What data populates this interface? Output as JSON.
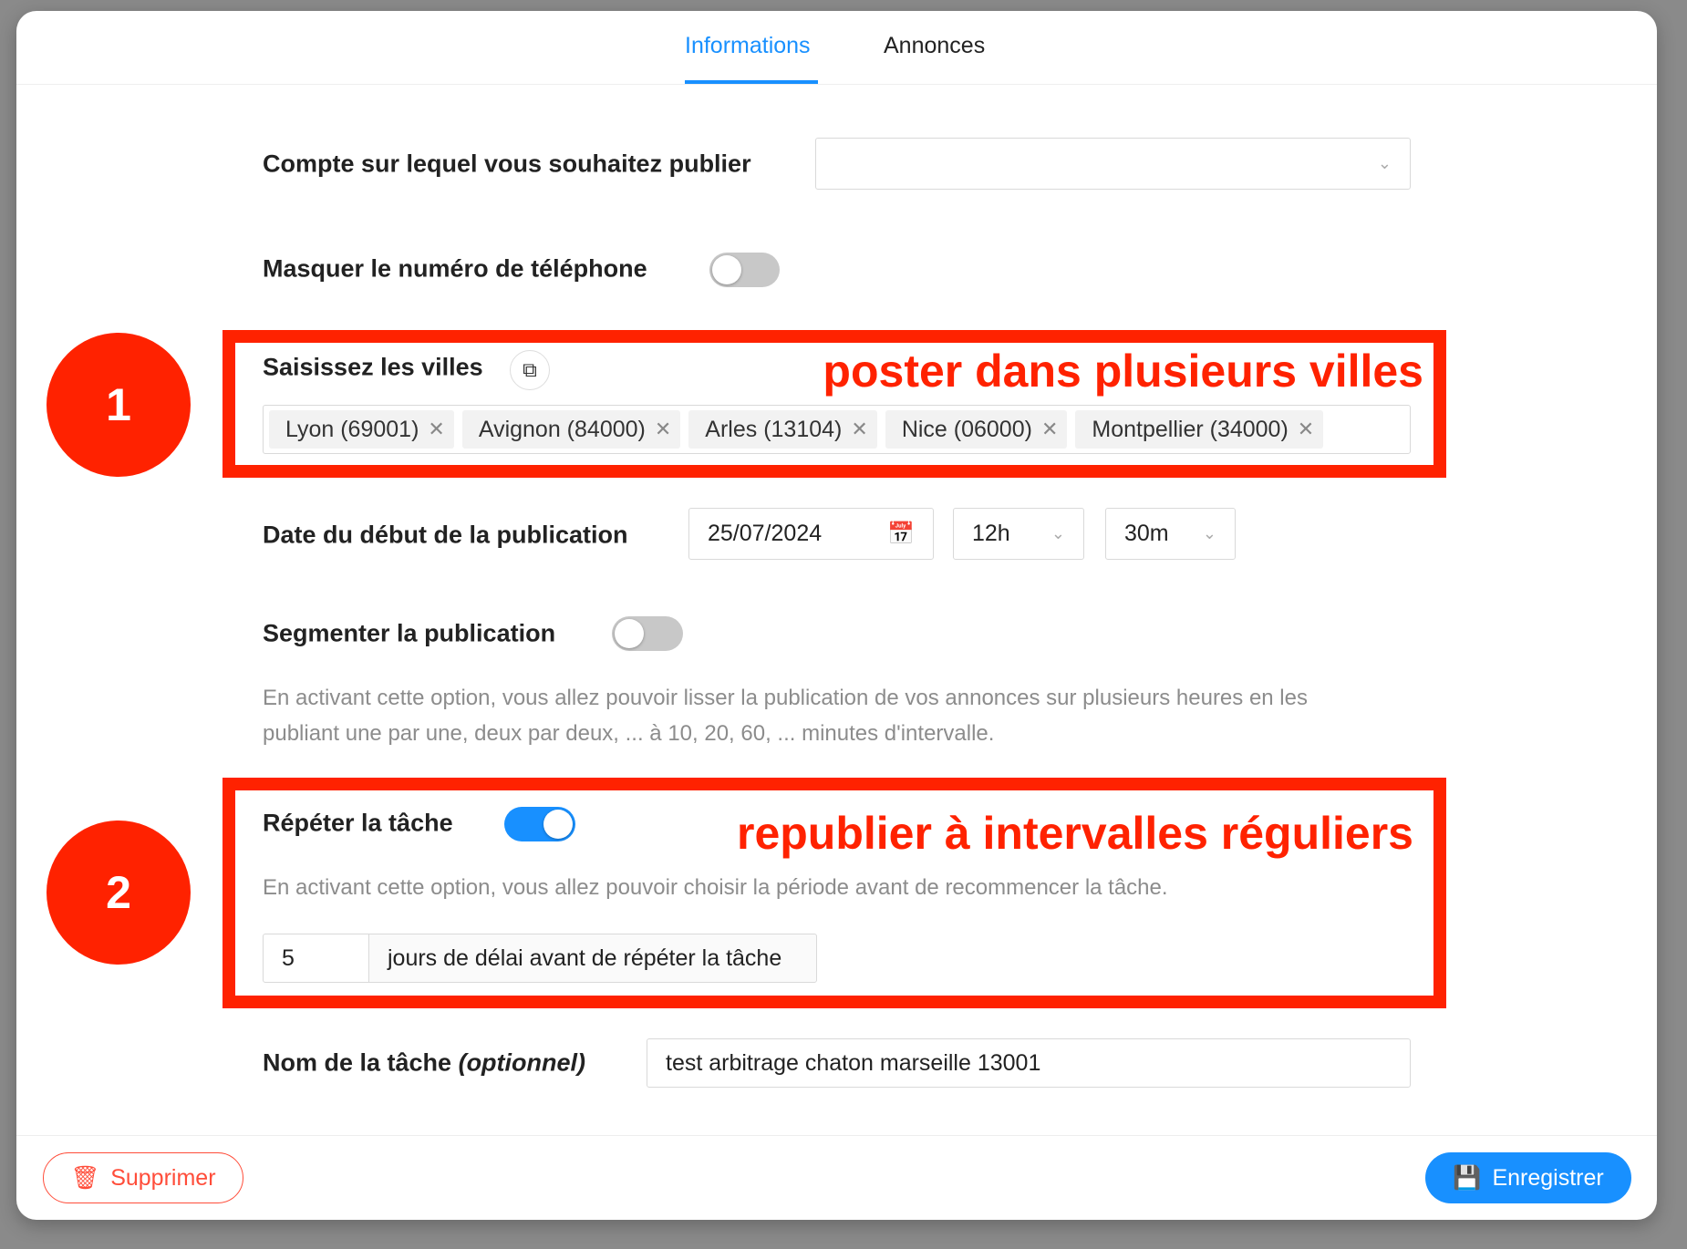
{
  "tabs": [
    {
      "label": "Informations",
      "active": true
    },
    {
      "label": "Annonces",
      "active": false
    }
  ],
  "account": {
    "label": "Compte sur lequel vous souhaitez publier",
    "value": ""
  },
  "hide_phone": {
    "label": "Masquer le numéro de téléphone",
    "on": false
  },
  "cities": {
    "label": "Saisissez les villes",
    "tags": [
      "Lyon (69001)",
      "Avignon (84000)",
      "Arles (13104)",
      "Nice (06000)",
      "Montpellier (34000)"
    ]
  },
  "start_date": {
    "label": "Date du début de la publication",
    "date": "25/07/2024",
    "hour": "12h",
    "minute": "30m"
  },
  "segment": {
    "label": "Segmenter la publication",
    "on": false,
    "description_1": "En activant cette option, vous allez pouvoir lisser la publication de vos annonces sur plusieurs heures en les",
    "description_2": "publiant une par une, deux par deux, ... à 10, 20, 60, ... minutes d'intervalle."
  },
  "repeat": {
    "label": "Répéter la tâche",
    "on": true,
    "description": "En activant cette option, vous allez pouvoir choisir la période avant de recommencer la tâche.",
    "days": "5",
    "days_addon": "jours de délai avant de répéter la tâche"
  },
  "task_name": {
    "label": "Nom de la tâche",
    "label_optional": "(optionnel)",
    "value": "test arbitrage chaton marseille 13001"
  },
  "annotations": {
    "one_number": "1",
    "one_text": "poster dans plusieurs villes",
    "two_number": "2",
    "two_text": "republier à intervalles réguliers"
  },
  "footer": {
    "delete_label": "Supprimer",
    "save_label": "Enregistrer"
  },
  "colors": {
    "accent": "#1890ff",
    "annotation": "#ff2200",
    "danger": "#ff4d3a"
  }
}
